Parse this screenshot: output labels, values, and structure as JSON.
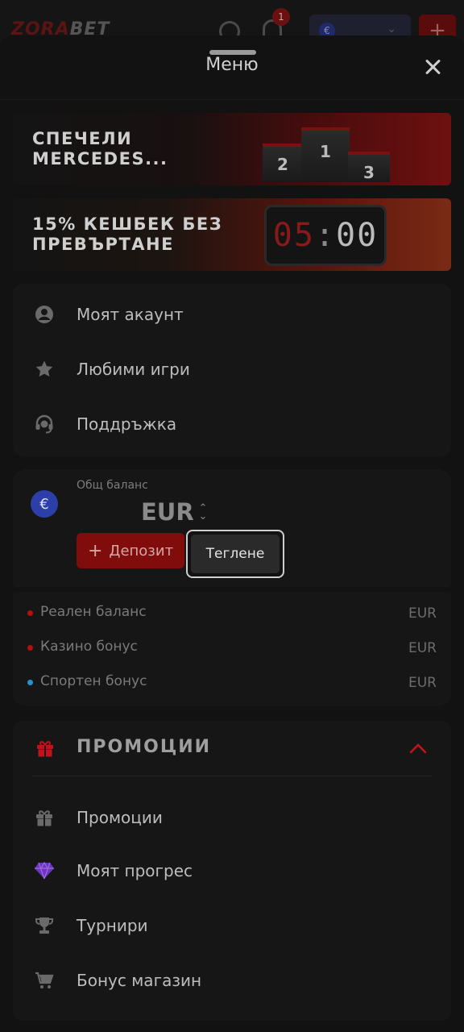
{
  "background": {
    "logo_part1": "ZORA",
    "logo_part2": "BET",
    "notification_count": "1",
    "currency_symbol": "€"
  },
  "sheet": {
    "title": "Меню"
  },
  "banners": [
    {
      "text_line1": "СПЕЧЕЛИ",
      "text_line2": "MERCEDES...",
      "podium_labels": [
        "2",
        "1",
        "3"
      ]
    },
    {
      "text_line1": "15% КЕШБЕК БЕЗ",
      "text_line2": "ПРЕВЪРТАНЕ",
      "timer_minutes": "05",
      "timer_colon": ":",
      "timer_seconds": "00"
    }
  ],
  "account_menu": [
    {
      "label": "Моят акаунт",
      "icon": "user-circle-icon"
    },
    {
      "label": "Любими игри",
      "icon": "star-icon"
    },
    {
      "label": "Поддръжка",
      "icon": "headset-icon"
    }
  ],
  "balance": {
    "label": "Общ баланс",
    "currency": "EUR",
    "currency_symbol": "€",
    "deposit_label": "Депозит",
    "withdraw_label": "Теглене",
    "rows": [
      {
        "name": "Реален баланс",
        "value": "EUR",
        "dot_color": "#b01010"
      },
      {
        "name": "Казино бонус",
        "value": "EUR",
        "dot_color": "#b01010"
      },
      {
        "name": "Спортен бонус",
        "value": "EUR",
        "dot_color": "#2a8fd0"
      }
    ]
  },
  "promotions": {
    "title": "ПРОМОЦИИ",
    "items": [
      {
        "label": "Промоции",
        "icon": "gift-icon"
      },
      {
        "label": "Моят прогрес",
        "icon": "diamond-icon"
      },
      {
        "label": "Турнири",
        "icon": "trophy-icon"
      },
      {
        "label": "Бонус магазин",
        "icon": "cart-icon"
      }
    ]
  },
  "colors": {
    "accent_red": "#800c0c",
    "promo_red": "#c0141a",
    "euro_blue": "#2c3fa8",
    "diamond_purple": "#7a3ad0"
  }
}
